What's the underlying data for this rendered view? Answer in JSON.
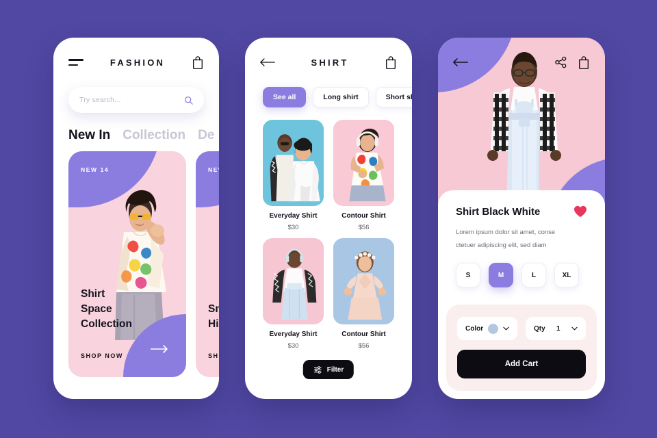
{
  "background_color": "#5148A3",
  "accent_purple": "#8B7CE0",
  "pink": "#F6C9D4",
  "heart_color": "#E8365D",
  "screen_home": {
    "header": {
      "menu_icon": "hamburger-icon",
      "brand": "FASHION",
      "bag_icon": "shopping-bag-icon"
    },
    "search": {
      "placeholder": "Try search...",
      "value": "",
      "icon": "search-icon"
    },
    "tabs": [
      {
        "label": "New In",
        "active": true
      },
      {
        "label": "Collection",
        "active": false
      },
      {
        "label": "De",
        "active": false
      }
    ],
    "cards": [
      {
        "badge": "NEW 14",
        "title": "Shirt\nSpace\nCollection",
        "cta": "SHOP NOW"
      },
      {
        "badge": "NEW",
        "title": "Sm\nHi",
        "cta": "SHO"
      }
    ]
  },
  "screen_list": {
    "header": {
      "back_icon": "back-arrow-icon",
      "title": "SHIRT",
      "bag_icon": "shopping-bag-icon"
    },
    "chips": [
      {
        "label": "See all",
        "active": true
      },
      {
        "label": "Long shirt",
        "active": false
      },
      {
        "label": "Short shirt",
        "active": false
      }
    ],
    "products": [
      {
        "name": "Everyday Shirt",
        "price": "$30",
        "bg": "#6EC4DD"
      },
      {
        "name": "Contour Shirt",
        "price": "$56",
        "bg": "#F9C9D6"
      },
      {
        "name": "Everyday Shirt",
        "price": "$30",
        "bg": "#F7C6D3"
      },
      {
        "name": "Contour Shirt",
        "price": "$56",
        "bg": "#A9C6E4"
      }
    ],
    "filter_button": {
      "label": "Filter",
      "icon": "sliders-icon"
    }
  },
  "screen_detail": {
    "header": {
      "back_icon": "back-arrow-icon",
      "share_icon": "share-icon",
      "bag_icon": "shopping-bag-icon"
    },
    "title": "Shirt Black White",
    "favorite_icon": "heart-icon",
    "description_line1": "Lorem ipsum dolor sit amet, conse",
    "description_line2": "ctetuer adipiscing elit, sed diam",
    "sizes": [
      {
        "label": "S",
        "active": false
      },
      {
        "label": "M",
        "active": true
      },
      {
        "label": "L",
        "active": false
      },
      {
        "label": "XL",
        "active": false
      }
    ],
    "color_selector": {
      "label": "Color",
      "swatch": "#B4C7E2",
      "chevron": "chevron-down-icon"
    },
    "qty_selector": {
      "label": "Qty",
      "value": "1",
      "chevron": "chevron-down-icon"
    },
    "add_cart_label": "Add Cart"
  }
}
